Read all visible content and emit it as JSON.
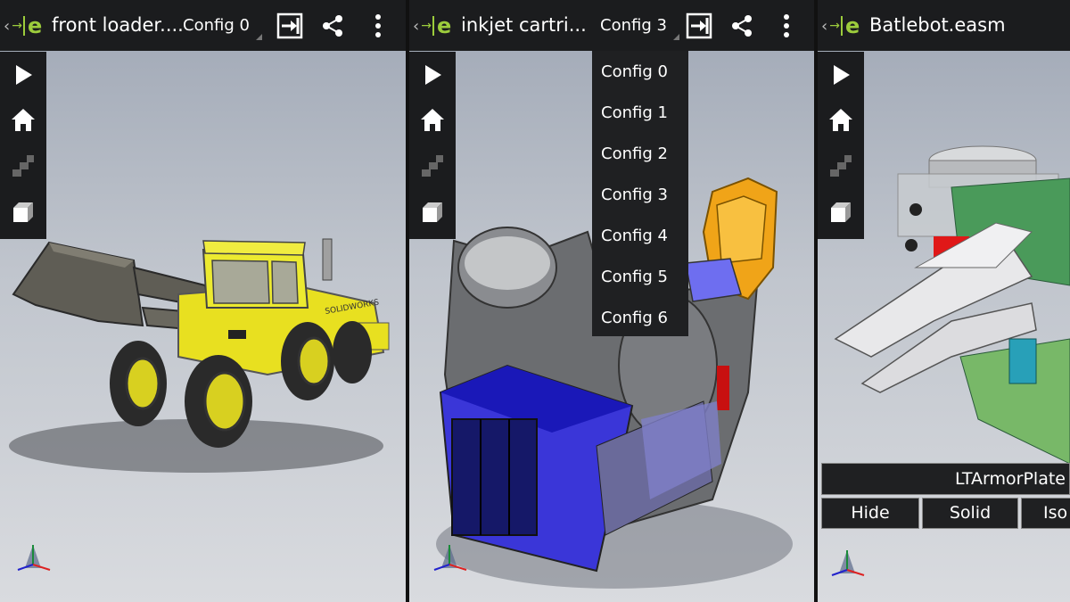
{
  "panels": [
    {
      "title": "front loader....",
      "config_label": "Config 0",
      "icons": [
        "back-chevron-icon",
        "edrawings-logo-icon",
        "fullscreen-icon",
        "share-icon",
        "overflow-menu-icon"
      ],
      "model": "front loader"
    },
    {
      "title": "inkjet cartri...",
      "config_label": "Config 3",
      "model": "inkjet cartridge",
      "config_menu": [
        "Config 0",
        "Config 1",
        "Config 2",
        "Config 3",
        "Config 4",
        "Config 5",
        "Config 6"
      ]
    },
    {
      "title": "Batlebot.easm",
      "model": "battlebot"
    }
  ],
  "left_toolbar": [
    "play-icon",
    "home-icon",
    "steps-icon",
    "component-icon"
  ],
  "component_panel": {
    "name": "LTArmorPlate",
    "buttons": [
      "Hide",
      "Solid",
      "Iso"
    ]
  },
  "colors": {
    "actionbar": "#1b1c1e",
    "accent_green": "#9ccc3c",
    "loader_yellow": "#e8e020",
    "cartridge_blue": "#3a36d8"
  }
}
